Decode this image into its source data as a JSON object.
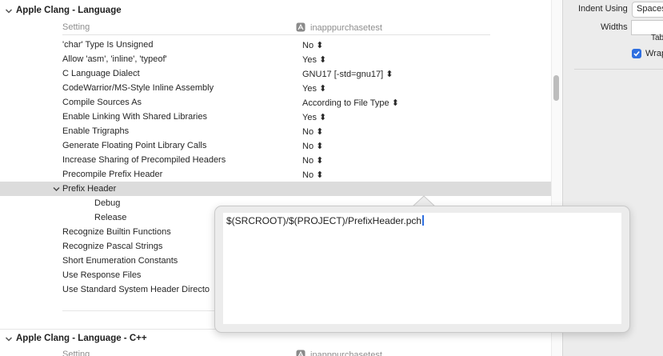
{
  "sections": [
    {
      "title": "Apple Clang - Language",
      "col_setting": "Setting",
      "col_target": "inapppurchasetest"
    },
    {
      "title": "Apple Clang - Language - C++",
      "col_setting": "Setting",
      "col_target": "inapppurchasetest"
    }
  ],
  "rows": [
    {
      "name": "'char' Type Is Unsigned",
      "value": "No ⬍"
    },
    {
      "name": "Allow 'asm', 'inline', 'typeof'",
      "value": "Yes ⬍"
    },
    {
      "name": "C Language Dialect",
      "value": "GNU17 [-std=gnu17] ⬍"
    },
    {
      "name": "CodeWarrior/MS-Style Inline Assembly",
      "value": "Yes ⬍"
    },
    {
      "name": "Compile Sources As",
      "value": "According to File Type ⬍"
    },
    {
      "name": "Enable Linking With Shared Libraries",
      "value": "Yes ⬍"
    },
    {
      "name": "Enable Trigraphs",
      "value": "No ⬍"
    },
    {
      "name": "Generate Floating Point Library Calls",
      "value": "No ⬍"
    },
    {
      "name": "Increase Sharing of Precompiled Headers",
      "value": "No ⬍"
    },
    {
      "name": "Precompile Prefix Header",
      "value": "No ⬍"
    },
    {
      "name": "Prefix Header",
      "value": ""
    },
    {
      "name": "Debug",
      "value": ""
    },
    {
      "name": "Release",
      "value": ""
    },
    {
      "name": "Recognize Builtin Functions",
      "value": ""
    },
    {
      "name": "Recognize Pascal Strings",
      "value": ""
    },
    {
      "name": "Short Enumeration Constants",
      "value": ""
    },
    {
      "name": "Use Response Files",
      "value": ""
    },
    {
      "name": "Use Standard System Header Directo",
      "value": ""
    }
  ],
  "popover": {
    "text": "$(SRCROOT)/$(PROJECT)/PrefixHeader.pch"
  },
  "inspector": {
    "indent_label": "Indent Using",
    "indent_value": "Spaces",
    "widths_label": "Widths",
    "tab_label": "Tab",
    "wrap_label": "Wrap"
  }
}
